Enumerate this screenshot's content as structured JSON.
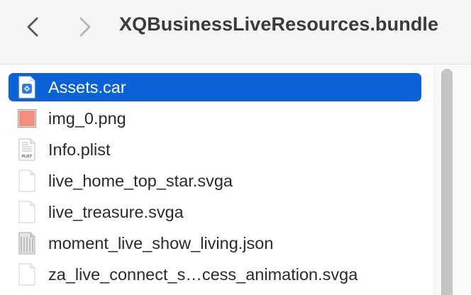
{
  "toolbar": {
    "back_icon": "chevron-left-icon",
    "forward_icon": "chevron-right-icon",
    "title": "XQBusinessLiveResources.bundle"
  },
  "files": [
    {
      "name": "Assets.car",
      "icon": "asset-catalog-icon",
      "selected": true
    },
    {
      "name": "img_0.png",
      "icon": "image-file-icon",
      "selected": false
    },
    {
      "name": "Info.plist",
      "icon": "plist-file-icon",
      "selected": false
    },
    {
      "name": "live_home_top_star.svga",
      "icon": "document-icon",
      "selected": false
    },
    {
      "name": "live_treasure.svga",
      "icon": "document-icon",
      "selected": false
    },
    {
      "name": "moment_live_show_living.json",
      "icon": "json-file-icon",
      "selected": false
    },
    {
      "name": "za_live_connect_s…cess_animation.svga",
      "icon": "document-icon",
      "selected": false
    }
  ],
  "colors": {
    "selection": "#0a62d6",
    "toolbar_bg": "#f6f5f4",
    "title_text": "#3a3a3a"
  }
}
